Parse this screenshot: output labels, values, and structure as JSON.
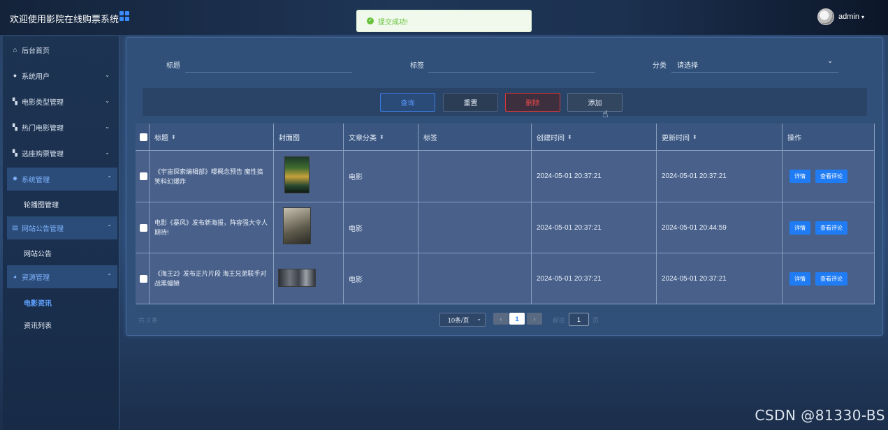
{
  "header": {
    "title": "欢迎使用影院在线购票系统",
    "username": "admin",
    "toast": "提交成功!"
  },
  "sidebar": {
    "items": [
      {
        "label": "后台首页",
        "icon": "home-icon"
      },
      {
        "label": "系统用户",
        "icon": "user-icon"
      },
      {
        "label": "电影类型管理",
        "icon": "grid-icon"
      },
      {
        "label": "热门电影管理",
        "icon": "grid-icon"
      },
      {
        "label": "选座购票管理",
        "icon": "grid-icon"
      },
      {
        "label": "系统管理",
        "icon": "gear-icon"
      },
      {
        "label": "网站公告管理",
        "icon": "notice-icon"
      },
      {
        "label": "资源管理",
        "icon": "pie-icon"
      }
    ],
    "sub": {
      "carousel": "轮播图管理",
      "notice": "网站公告",
      "news": "电影资讯",
      "list": "资讯列表"
    }
  },
  "filters": {
    "title_label": "标题",
    "tag_label": "标签",
    "category_label": "分类",
    "category_placeholder": "请选择"
  },
  "toolbar": {
    "query": "查询",
    "reset": "重置",
    "delete": "删除",
    "add": "添加"
  },
  "table": {
    "columns": [
      "标题",
      "封面图",
      "文章分类",
      "标签",
      "创建时间",
      "更新时间",
      "操作"
    ],
    "rows": [
      {
        "title": "《宇宙探索编辑部》曝概念预告 魔性搞笑科幻爆炸",
        "category": "电影",
        "tag": "",
        "created": "2024-05-01 20:37:21",
        "updated": "2024-05-01 20:37:21"
      },
      {
        "title": "电影《暴风》发布新海报，阵容强大令人期待!",
        "category": "电影",
        "tag": "",
        "created": "2024-05-01 20:37:21",
        "updated": "2024-05-01 20:44:59"
      },
      {
        "title": "《海王2》发布正片片段 海王兄弟联手对战黑蝠鲼",
        "category": "电影",
        "tag": "",
        "created": "2024-05-01 20:37:21",
        "updated": "2024-05-01 20:37:21"
      }
    ],
    "detail_label": "详情",
    "comment_label": "查看评论"
  },
  "pager": {
    "total": "共 3 条",
    "page_size": "10条/页",
    "current_page": "1",
    "goto_prefix": "前往",
    "goto_value": "1",
    "goto_suffix": "页"
  },
  "watermark": "CSDN @81330-BS",
  "colors": {
    "accent": "#1f7cf5",
    "danger": "#ee4a4a",
    "success": "#67c23a"
  }
}
